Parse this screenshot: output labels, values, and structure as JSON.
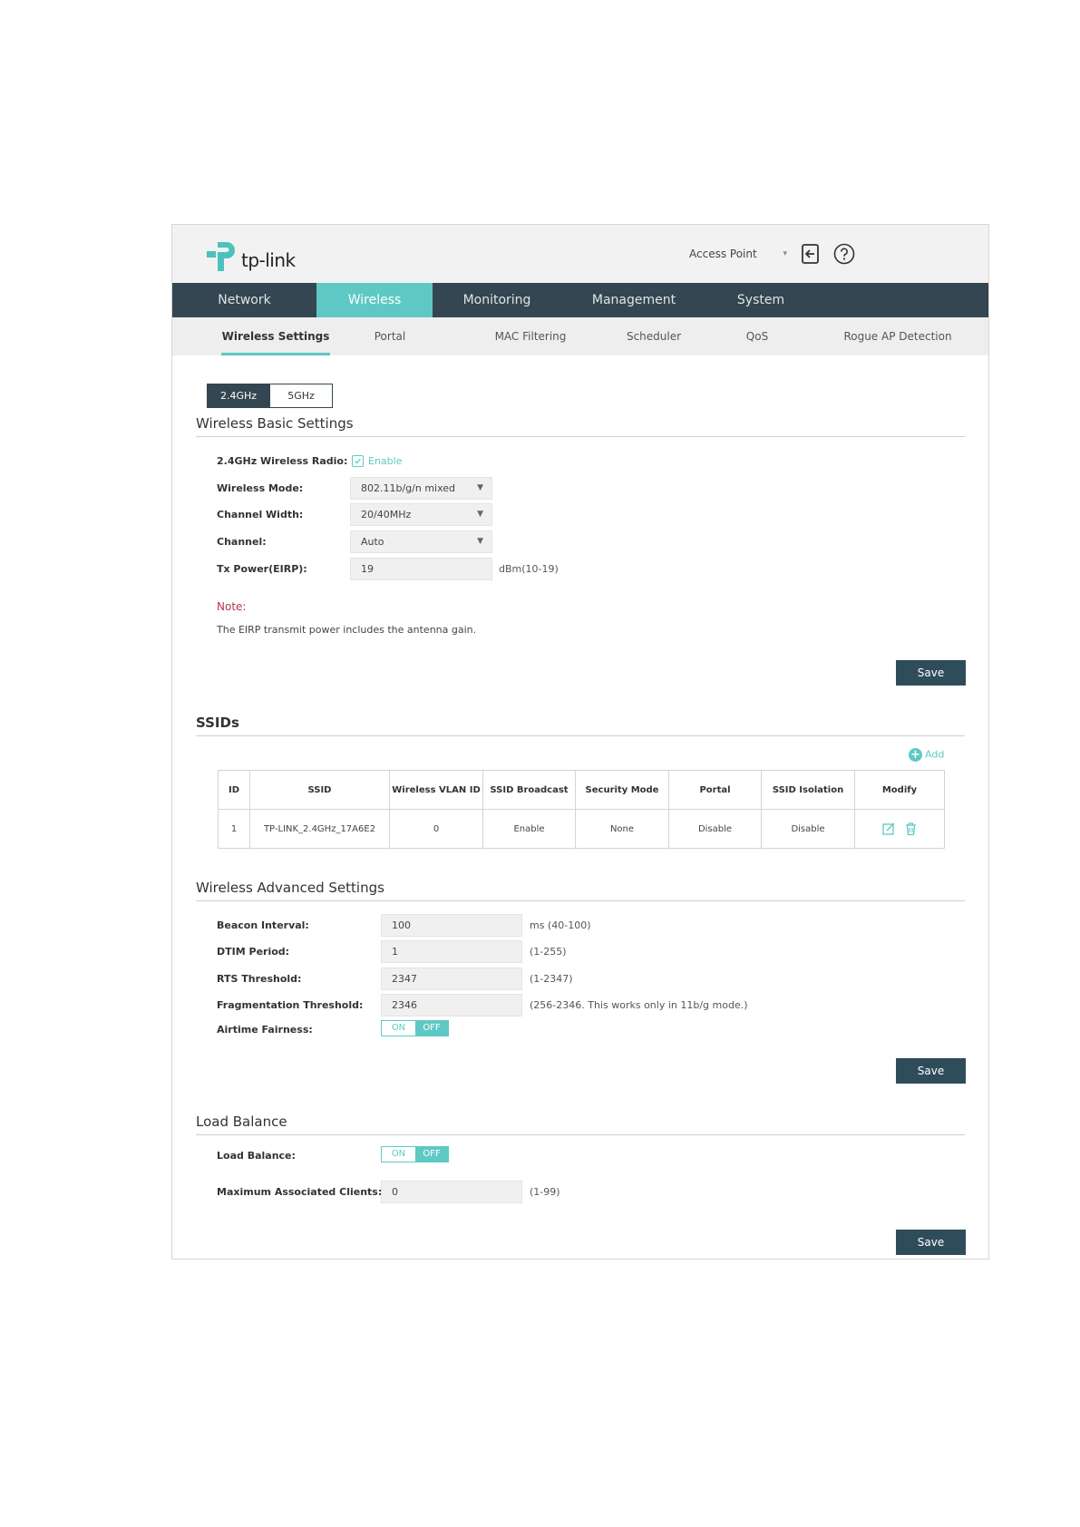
{
  "header": {
    "logo_text": "tp-link",
    "mode": "Access Point"
  },
  "main_nav": [
    "Network",
    "Wireless",
    "Monitoring",
    "Management",
    "System"
  ],
  "sub_nav": [
    "Wireless Settings",
    "Portal",
    "MAC Filtering",
    "Scheduler",
    "QoS",
    "Rogue AP Detection"
  ],
  "bands": [
    "2.4GHz",
    "5GHz"
  ],
  "basic": {
    "title": "Wireless Basic Settings",
    "radio_label": "2.4GHz Wireless Radio:",
    "radio_value": "Enable",
    "mode_label": "Wireless Mode:",
    "mode_value": "802.11b/g/n mixed",
    "width_label": "Channel Width:",
    "width_value": "20/40MHz",
    "channel_label": "Channel:",
    "channel_value": "Auto",
    "power_label": "Tx Power(EIRP):",
    "power_value": "19",
    "power_hint": "dBm(10-19)",
    "note_title": "Note:",
    "note_text": "The EIRP transmit power includes the antenna gain.",
    "save": "Save"
  },
  "ssids": {
    "title": "SSIDs",
    "add": "Add",
    "columns": [
      "ID",
      "SSID",
      "Wireless VLAN ID",
      "SSID Broadcast",
      "Security Mode",
      "Portal",
      "SSID Isolation",
      "Modify"
    ],
    "rows": [
      [
        "1",
        "TP-LINK_2.4GHz_17A6E2",
        "0",
        "Enable",
        "None",
        "Disable",
        "Disable"
      ]
    ]
  },
  "advanced": {
    "title": "Wireless Advanced Settings",
    "beacon_label": "Beacon Interval:",
    "beacon_value": "100",
    "beacon_hint": "ms (40-100)",
    "dtim_label": "DTIM Period:",
    "dtim_value": "1",
    "dtim_hint": "(1-255)",
    "rts_label": "RTS Threshold:",
    "rts_value": "2347",
    "rts_hint": "(1-2347)",
    "frag_label": "Fragmentation Threshold:",
    "frag_value": "2346",
    "frag_hint": "(256-2346. This works only in 11b/g mode.)",
    "airtime_label": "Airtime Fairness:",
    "toggle_on": "ON",
    "toggle_off": "OFF",
    "save": "Save"
  },
  "load_balance": {
    "title": "Load Balance",
    "lb_label": "Load Balance:",
    "toggle_on": "ON",
    "toggle_off": "OFF",
    "max_label": "Maximum Associated Clients:",
    "max_value": "0",
    "max_hint": "(1-99)",
    "save": "Save"
  },
  "colors": {
    "accent": "#5ec9c4",
    "nav": "#334651",
    "button": "#2f4c5b"
  }
}
